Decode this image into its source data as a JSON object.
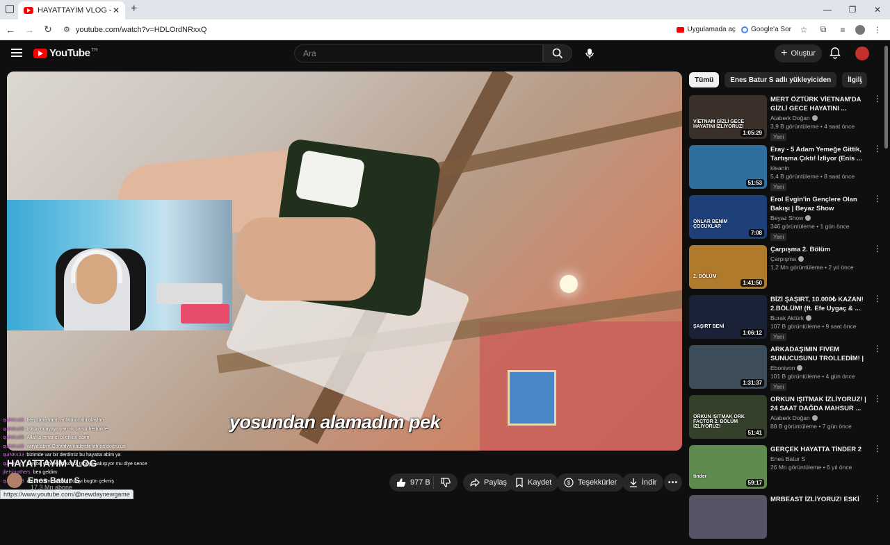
{
  "browser": {
    "tab_title": "HAYATTAYIM VLOG - YouTube",
    "url": "youtube.com/watch?v=HDLOrdNRxxQ",
    "open_in_app": "Uygulamada aç",
    "ask_google": "Google'a Sor",
    "status_url": "https://www.youtube.com/@newdaynewgame"
  },
  "header": {
    "logo_text": "YouTube",
    "country": "TR",
    "search_placeholder": "Ara",
    "create_label": "Oluştur"
  },
  "video": {
    "subtitle": "yosundan alamadım pek",
    "title": "HAYATTAYIM VLOG",
    "channel_name": "Enes Batur S",
    "subscribers": "17,3 Mn abone",
    "likes": "977 B",
    "share": "Paylaş",
    "save": "Kaydet",
    "thanks": "Teşekkürler",
    "download": "İndir"
  },
  "chat": [
    {
      "user": "quiNKs33",
      "text": "ben sana yarın anlatırım abi olayları"
    },
    {
      "user": "quiNKs33",
      "text": "bütün dünyaya yatcak sandı herhalde"
    },
    {
      "user": "quiNKs33",
      "text": "Allah'a emanet ol erkan abim"
    },
    {
      "user": "quiNKs33",
      "text": "varya abim Coğrafya kaderdir lafı ne doğru ua"
    },
    {
      "user": "quiNKs33",
      "text": "bizimde var bir derdimiz bu hayatta abim ya"
    },
    {
      "user": "quiNKs33",
      "text": "ben bu sahneden sonra tebriyk yakışıyor mu diye sence"
    },
    {
      "user": "jiletsbrothers",
      "text": "ben geldim"
    },
    {
      "user": "quiNKs33",
      "text": "abi on kameramanı dolayı bugün çekmiş"
    }
  ],
  "sidebar": {
    "chips": [
      "Tümü",
      "Enes Batur S adlı yükleyiciden",
      "İlgili"
    ],
    "recommendations": [
      {
        "title": "MERT ÖZTÜRK VİETNAM'DA GİZLİ GECE HAYATINI ...",
        "channel": "Ataberk Doğan",
        "verified": true,
        "meta": "3,9 B görüntüleme • 4 saat önce",
        "badge": "Yeni",
        "duration": "1:05:29",
        "thumb_text": "VİETNAM GİZLİ GECE HAYATINI İZLİYORUZ!",
        "thumb_color": "#3b2f2a"
      },
      {
        "title": "Eray - 5 Adam Yemeğe Gittik, Tartışma Çıktı! İzliyor (Enis ...",
        "channel": "kleanin",
        "verified": false,
        "meta": "5,4 B görüntüleme • 8 saat önce",
        "badge": "Yeni",
        "duration": "51:53",
        "thumb_text": "",
        "thumb_color": "#2e6fa0"
      },
      {
        "title": "Erol Evgin'in Gençlere Olan Bakışı | Beyaz Show",
        "channel": "Beyaz Show",
        "verified": true,
        "meta": "346 görüntüleme • 1 gün önce",
        "badge": "Yeni",
        "duration": "7:08",
        "thumb_text": "ONLAR BENİM ÇOCUKLAR",
        "thumb_color": "#1d3f7a"
      },
      {
        "title": "Çarpışma 2. Bölüm",
        "channel": "Çarpışma",
        "verified": true,
        "meta": "1,2 Mn görüntüleme • 2 yıl önce",
        "badge": "",
        "duration": "1:41:50",
        "thumb_text": "2. BÖLÜM",
        "thumb_color": "#b07a2c"
      },
      {
        "title": "BİZİ ŞAŞIRT, 10.000₺ KAZAN! 2.BÖLÜM! (ft. Efe Uygaç & ...",
        "channel": "Burak Aktürk",
        "verified": true,
        "meta": "107 B görüntüleme • 9 saat önce",
        "badge": "Yeni",
        "duration": "1:06:12",
        "thumb_text": "ŞAŞIRT BENİ",
        "thumb_color": "#1a2238"
      },
      {
        "title": "ARKADAŞIMIN FIVEM SUNUCUSUNU TROLLEDİM! | ...",
        "channel": "Ebonivon",
        "verified": true,
        "meta": "101 B görüntüleme • 4 gün önce",
        "badge": "Yeni",
        "duration": "1:31:37",
        "thumb_text": "",
        "thumb_color": "#3d4d5a"
      },
      {
        "title": "ORKUN IŞITMAK İZLİYORUZ! | 24 SAAT DAĞDA MAHSUR ...",
        "channel": "Ataberk Doğan",
        "verified": true,
        "meta": "88 B görüntüleme • 7 gün önce",
        "badge": "",
        "duration": "51:41",
        "thumb_text": "ORKUN IŞITMAK ORK FACTOR 2. BÖLÜM İZLİYORUZ!",
        "thumb_color": "#34402a"
      },
      {
        "title": "GERÇEK HAYATTA TİNDER 2",
        "channel": "Enes Batur S",
        "verified": false,
        "meta": "26 Mn görüntüleme • 6 yıl önce",
        "badge": "",
        "duration": "59:17",
        "thumb_text": "tinder",
        "thumb_color": "#5e8a4e"
      },
      {
        "title": "MRBEAST İZLİYORUZ! ESKİ",
        "channel": "",
        "verified": false,
        "meta": "",
        "badge": "",
        "duration": "",
        "thumb_text": "",
        "thumb_color": "#556"
      }
    ]
  },
  "colors": {
    "background": "#0f0f0f",
    "youtube_red": "#ff0000",
    "chip_bg": "#272727"
  }
}
